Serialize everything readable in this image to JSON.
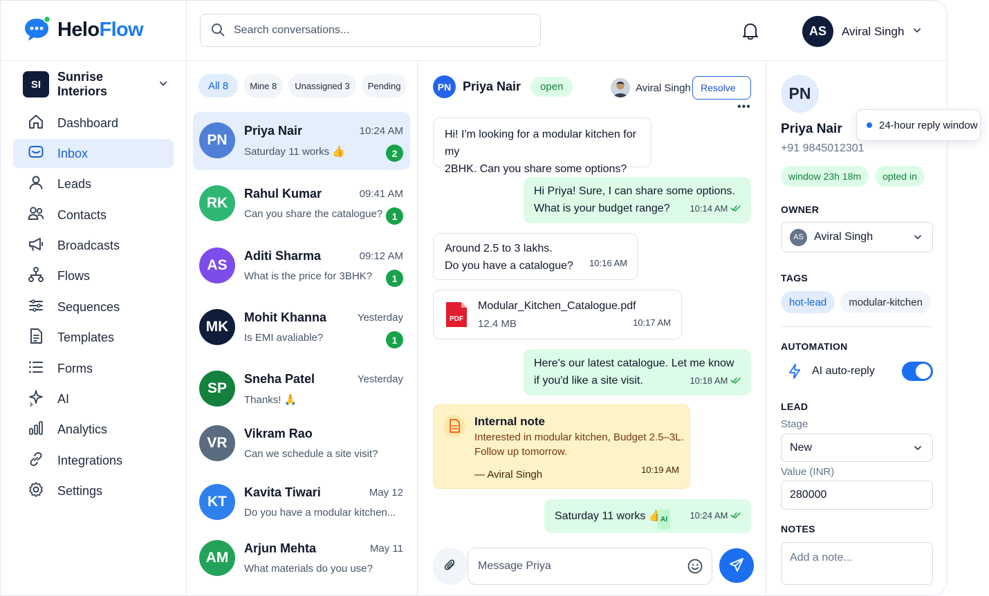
{
  "brand": {
    "name_part1": "Helo",
    "name_part2": "Flow"
  },
  "workspace": {
    "initials": "SI",
    "name": "Sunrise Interiors"
  },
  "nav": [
    {
      "label": "Dashboard",
      "icon": "home-icon"
    },
    {
      "label": "Inbox",
      "icon": "inbox-icon",
      "active": true
    },
    {
      "label": "Leads",
      "icon": "user-icon"
    },
    {
      "label": "Contacts",
      "icon": "users-icon"
    },
    {
      "label": "Broadcasts",
      "icon": "megaphone-icon"
    },
    {
      "label": "Flows",
      "icon": "flow-icon"
    },
    {
      "label": "Sequences",
      "icon": "sequence-icon"
    },
    {
      "label": "Templates",
      "icon": "template-icon"
    },
    {
      "label": "Forms",
      "icon": "list-icon"
    },
    {
      "label": "AI",
      "icon": "sparkle-icon"
    },
    {
      "label": "Analytics",
      "icon": "bar-chart-icon"
    },
    {
      "label": "Integrations",
      "icon": "link-icon"
    },
    {
      "label": "Settings",
      "icon": "gear-icon"
    }
  ],
  "search": {
    "placeholder": "Search conversations..."
  },
  "user": {
    "initials": "AS",
    "name": "Aviral Singh"
  },
  "filters": [
    {
      "label": "All",
      "count": "8",
      "active": true
    },
    {
      "label": "Mine",
      "count": "8"
    },
    {
      "label": "Unassigned",
      "count": "3"
    },
    {
      "label": "Pending",
      "count": ""
    }
  ],
  "conversations": [
    {
      "initials": "PN",
      "name": "Priya Nair",
      "time": "10:24 AM",
      "preview": "Saturday 11 works 👍",
      "unread": "2",
      "color": "#4f7fd6",
      "selected": true
    },
    {
      "initials": "RK",
      "name": "Rahul Kumar",
      "time": "09:41 AM",
      "preview": "Can you share the catalogue?",
      "unread": "1",
      "color": "#2fb673"
    },
    {
      "initials": "AS",
      "name": "Aditi Sharma",
      "time": "09:12 AM",
      "preview": "What is the price for 3BHK?",
      "unread": "1",
      "color": "#7c4dea"
    },
    {
      "initials": "MK",
      "name": "Mohit Khanna",
      "time": "Yesterday",
      "preview": "Is EMI avaliable?",
      "unread": "1",
      "color": "#0f1d3a"
    },
    {
      "initials": "SP",
      "name": "Sneha Patel",
      "time": "Yesterday",
      "preview": "Thanks! 🙏",
      "unread": "",
      "color": "#13803d"
    },
    {
      "initials": "VR",
      "name": "Vikram Rao",
      "time": "",
      "preview": "Can we schedule a site visit?",
      "unread": "",
      "color": "#5b6b80"
    },
    {
      "initials": "KT",
      "name": "Kavita Tiwari",
      "time": "May 12",
      "preview": "Do you have a modular kitchen...",
      "unread": "",
      "color": "#2f80ed"
    },
    {
      "initials": "AM",
      "name": "Arjun Mehta",
      "time": "May 11",
      "preview": "What materials do you use?",
      "unread": "",
      "color": "#23a35a"
    }
  ],
  "chat": {
    "contact_initials": "PN",
    "contact_name": "Priya Nair",
    "status": "open",
    "assignee": "Aviral Singh",
    "resolve_label": "Resolve",
    "more": "•••",
    "messages": {
      "m1": {
        "line1": "Hi! I'm looking for a modular kitchen for my",
        "line2": "2BHK. Can you share some options?"
      },
      "m2": {
        "line1": "Hi Priya! Sure, I can share some options.",
        "line2": "What is your budget range?",
        "time": "10:14 AM"
      },
      "m3": {
        "line1": "Around 2.5 to 3 lakhs.",
        "line2": "Do you have a catalogue?",
        "time": "10:16 AM"
      },
      "m4": {
        "file_name": "Modular_Kitchen_Catalogue.pdf",
        "file_size": "12.4 MB",
        "file_type": "PDF",
        "time": "10:17 AM"
      },
      "m5": {
        "line1": "Here's our latest catalogue. Let me know",
        "line2": "if you'd like a site visit.",
        "time": "10:18 AM"
      },
      "note": {
        "title": "Internal note",
        "line1": "Interested in modular kitchen, Budget 2.5–3L.",
        "line2": "Follow up tomorrow.",
        "author": "— Aviral Singh",
        "time": "10:19 AM"
      },
      "m6": {
        "text": "Saturday 11 works 👍",
        "ai_badge": "AI",
        "time": "10:24 AM"
      }
    },
    "composer_placeholder": "Message Priya"
  },
  "panel": {
    "initials": "PN",
    "name": "Priya Nair",
    "phone": "+91 9845012301",
    "window_badge": "window 23h 18m",
    "opted_badge": "opted in",
    "tooltip": "24-hour reply window",
    "owner_title": "OWNER",
    "owner_initials": "AS",
    "owner_name": "Aviral Singh",
    "tags_title": "TAGS",
    "tags": [
      "hot-lead",
      "modular-kitchen"
    ],
    "automation_title": "AUTOMATION",
    "automation_label": "AI auto-reply",
    "automation_on": true,
    "lead_title": "LEAD",
    "stage_label": "Stage",
    "stage_value": "New",
    "value_label": "Value (INR)",
    "value": "280000",
    "notes_title": "NOTES",
    "notes_placeholder": "Add a note..."
  },
  "colors": {
    "accent": "#1d6ff2",
    "green": "#16a34a",
    "navy": "#0f1d3a"
  }
}
